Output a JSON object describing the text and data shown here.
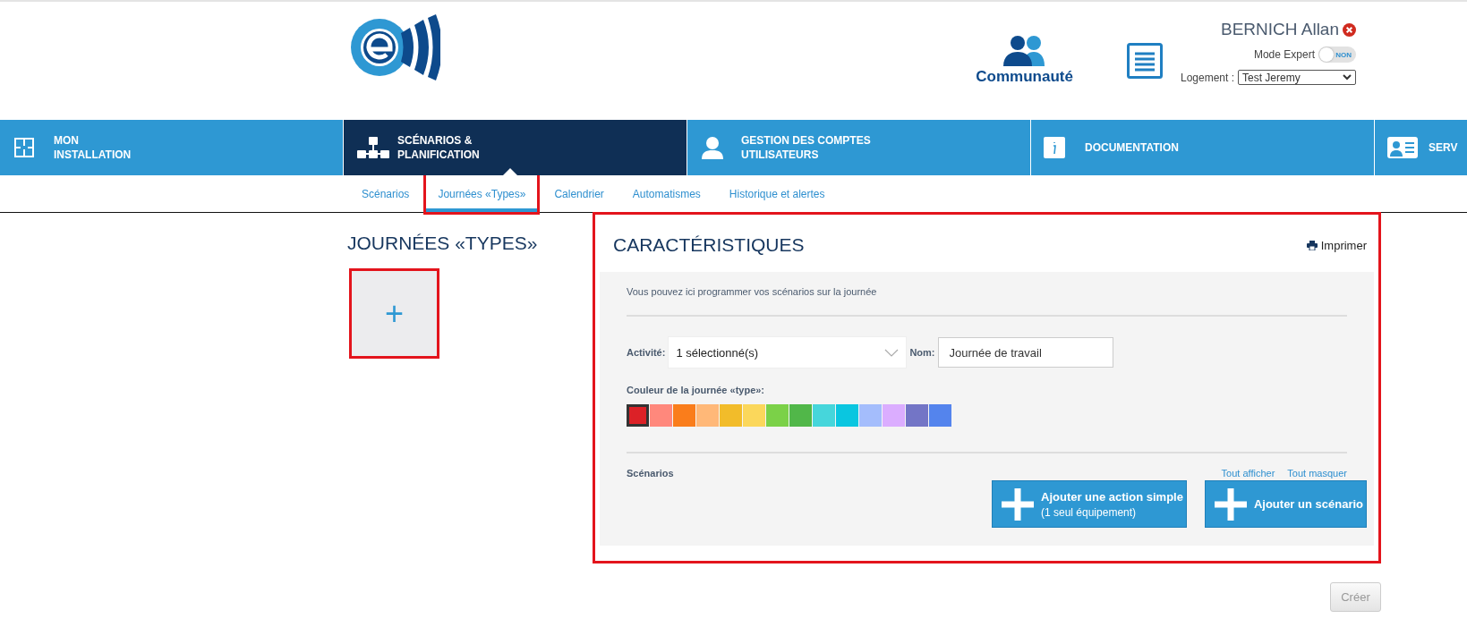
{
  "header": {
    "community_label": "Communauté",
    "user_name": "BERNICH Allan",
    "expert_mode": {
      "label": "Mode Expert",
      "on": false,
      "state_text": "NON"
    },
    "housing": {
      "label": "Logement :",
      "value": "Test Jeremy"
    }
  },
  "nav": [
    {
      "lines": [
        "MON",
        "INSTALLATION"
      ],
      "selected": false
    },
    {
      "lines": [
        "SCÉNARIOS &",
        "PLANIFICATION"
      ],
      "selected": true
    },
    {
      "lines": [
        "GESTION DES COMPTES",
        "UTILISATEURS"
      ],
      "selected": false
    },
    {
      "lines": [
        "DOCUMENTATION"
      ],
      "selected": false
    },
    {
      "lines": [
        "SERV"
      ],
      "selected": false
    }
  ],
  "subnav": [
    {
      "label": "Scénarios",
      "selected": false,
      "highlighted": false
    },
    {
      "label": "Journées «Types»",
      "selected": true,
      "highlighted": true
    },
    {
      "label": "Calendrier",
      "selected": false,
      "highlighted": false
    },
    {
      "label": "Automatismes",
      "selected": false,
      "highlighted": false
    },
    {
      "label": "Historique et alertes",
      "selected": false,
      "highlighted": false
    }
  ],
  "left": {
    "title": "JOURNÉES «TYPES»",
    "add_card": {
      "label": "+",
      "highlighted": true
    }
  },
  "panel": {
    "title": "CARACTÉRISTIQUES",
    "highlighted": true,
    "print_label": "Imprimer",
    "intro": "Vous pouvez ici programmer vos scénarios sur la journée",
    "activity": {
      "label": "Activité:",
      "value": "1 sélectionné(s)"
    },
    "name": {
      "label": "Nom:",
      "value": "Journée de travail"
    },
    "color_label": "Couleur de la journée «type»:",
    "colors": [
      {
        "color": "#dc2127",
        "selected": true
      },
      {
        "color": "#ff887c",
        "selected": false
      },
      {
        "color": "#fa7d1b",
        "selected": false
      },
      {
        "color": "#ffb878",
        "selected": false
      },
      {
        "color": "#f2bc2a",
        "selected": false
      },
      {
        "color": "#fbd75b",
        "selected": false
      },
      {
        "color": "#7bd148",
        "selected": false
      },
      {
        "color": "#51b749",
        "selected": false
      },
      {
        "color": "#46d6db",
        "selected": false
      },
      {
        "color": "#0ac6e0",
        "selected": false
      },
      {
        "color": "#a4bdfc",
        "selected": false
      },
      {
        "color": "#dbadff",
        "selected": false
      },
      {
        "color": "#7375c6",
        "selected": false
      },
      {
        "color": "#5484ed",
        "selected": false
      }
    ],
    "scenarios_label": "Scénarios",
    "links": [
      "Tout afficher",
      "Tout masquer"
    ],
    "buttons": [
      {
        "title": "Ajouter une action simple",
        "subtitle": "(1 seul équipement)"
      },
      {
        "title": "Ajouter un scénario"
      }
    ]
  },
  "create_button": {
    "label": "Créer",
    "disabled": true
  }
}
